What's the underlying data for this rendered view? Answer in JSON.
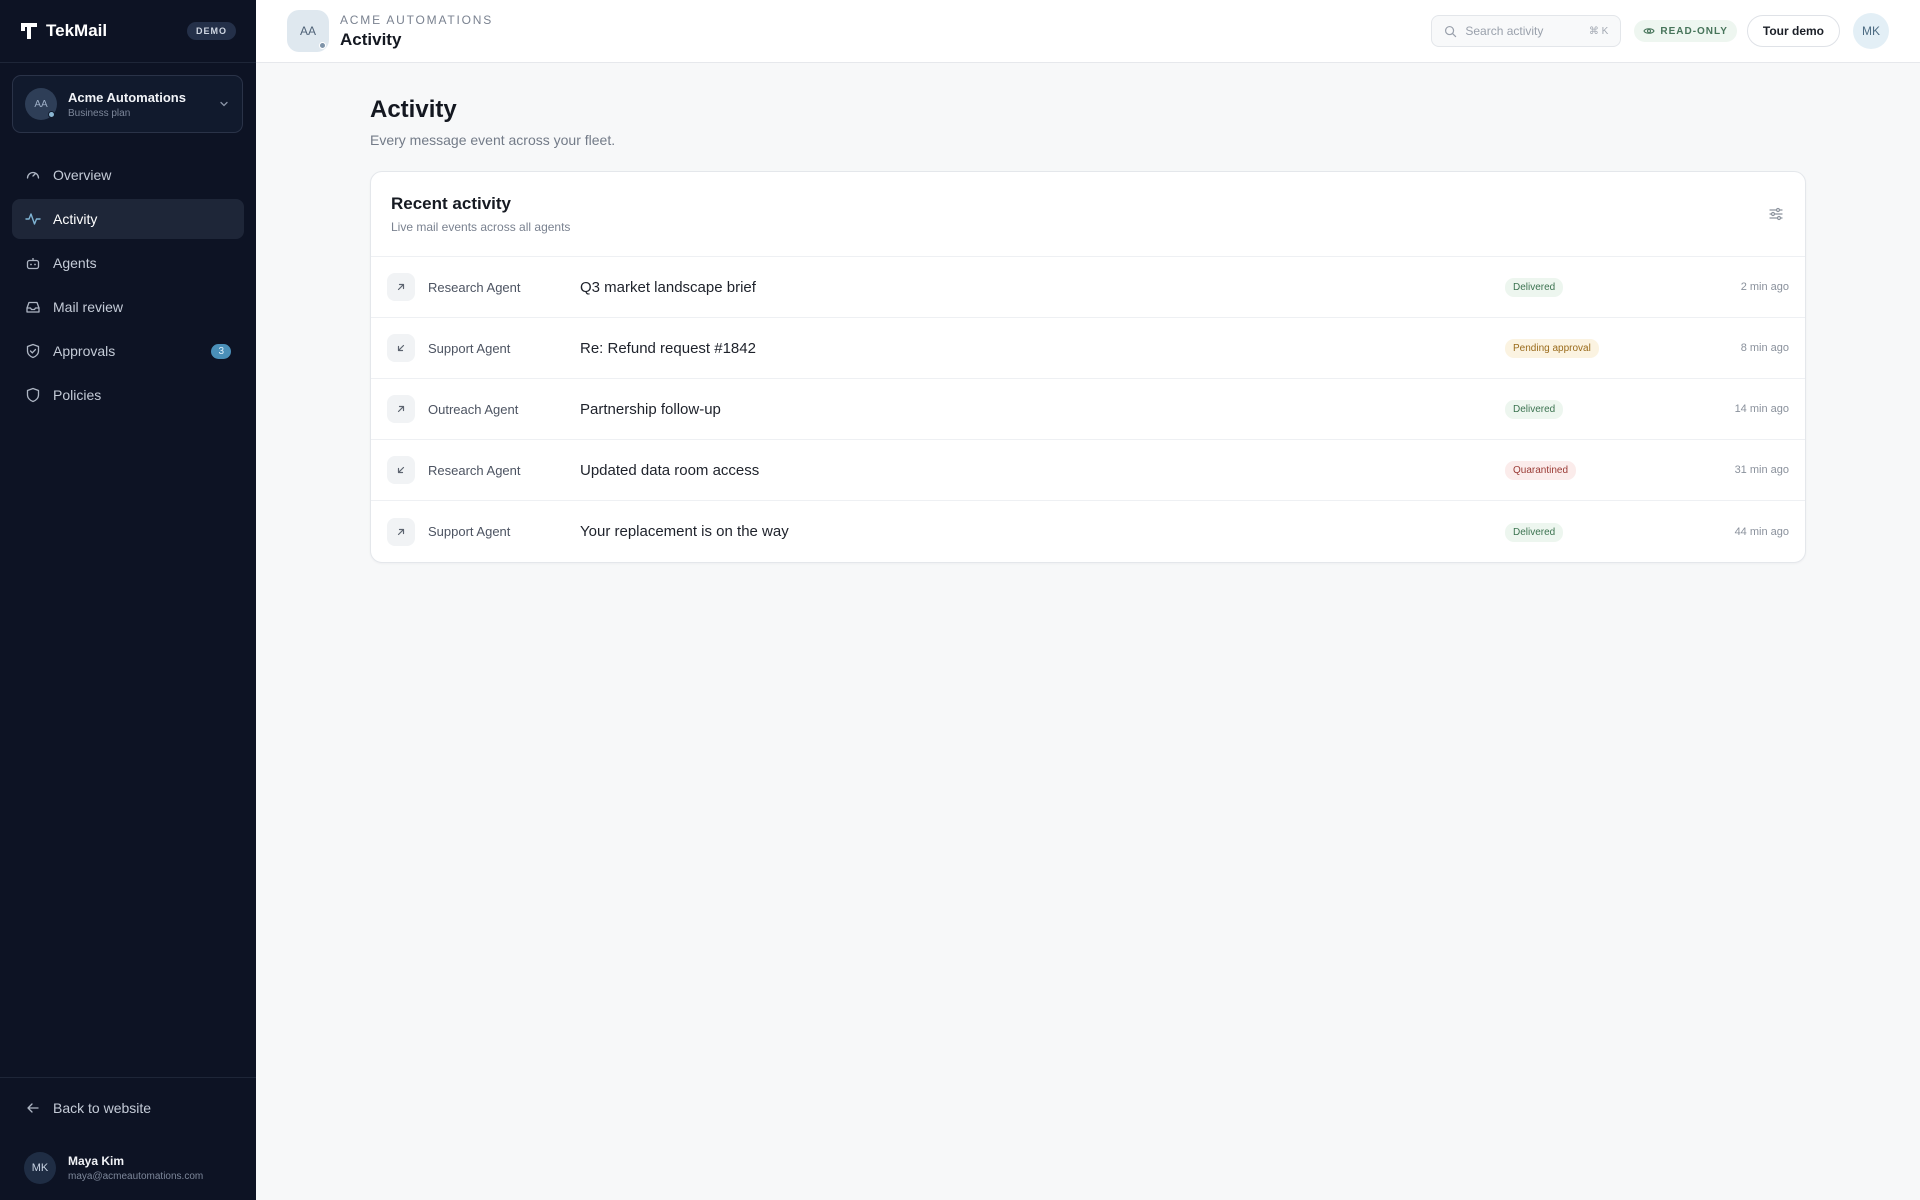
{
  "app": {
    "name": "TekMail",
    "badge": "DEMO"
  },
  "org": {
    "initials": "AA",
    "name": "Acme Automations",
    "plan": "Business plan"
  },
  "nav": [
    {
      "label": "Overview",
      "icon": "gauge-icon"
    },
    {
      "label": "Activity",
      "icon": "activity-icon",
      "active": true
    },
    {
      "label": "Agents",
      "icon": "bot-icon"
    },
    {
      "label": "Mail review",
      "icon": "inbox-icon"
    },
    {
      "label": "Approvals",
      "icon": "shield-check-icon",
      "badge": "3"
    },
    {
      "label": "Policies",
      "icon": "shield-icon"
    }
  ],
  "sidebar_footer": {
    "back_label": "Back to website"
  },
  "user": {
    "initials": "MK",
    "name": "Maya Kim",
    "email": "maya@acmeautomations.com"
  },
  "header": {
    "org_initials": "AA",
    "org_label": "ACME AUTOMATIONS",
    "title": "Activity",
    "search_placeholder": "Search activity",
    "search_shortcut": "⌘ K",
    "readonly_label": "READ-ONLY",
    "tour_label": "Tour demo",
    "user_initials": "MK"
  },
  "page": {
    "title": "Activity",
    "subtitle": "Every message event across your fleet."
  },
  "card": {
    "title": "Recent activity",
    "subtitle": "Live mail events across all agents"
  },
  "rows": [
    {
      "direction": "outbound",
      "agent": "Research Agent",
      "subject": "Q3 market landscape brief",
      "status": "Delivered",
      "status_type": "delivered",
      "time": "2 min ago"
    },
    {
      "direction": "inbound",
      "agent": "Support Agent",
      "subject": "Re: Refund request #1842",
      "status": "Pending approval",
      "status_type": "pending",
      "time": "8 min ago"
    },
    {
      "direction": "outbound",
      "agent": "Outreach Agent",
      "subject": "Partnership follow-up",
      "status": "Delivered",
      "status_type": "delivered",
      "time": "14 min ago"
    },
    {
      "direction": "inbound",
      "agent": "Research Agent",
      "subject": "Updated data room access",
      "status": "Quarantined",
      "status_type": "quarantined",
      "time": "31 min ago"
    },
    {
      "direction": "outbound",
      "agent": "Support Agent",
      "subject": "Your replacement is on the way",
      "status": "Delivered",
      "status_type": "delivered",
      "time": "44 min ago"
    }
  ],
  "colors": {
    "sidebar_bg": "#0d1324",
    "accent": "#4a8fb8",
    "delivered": "#3c7350",
    "pending": "#9a6b1b",
    "quarantined": "#9a3b35"
  }
}
